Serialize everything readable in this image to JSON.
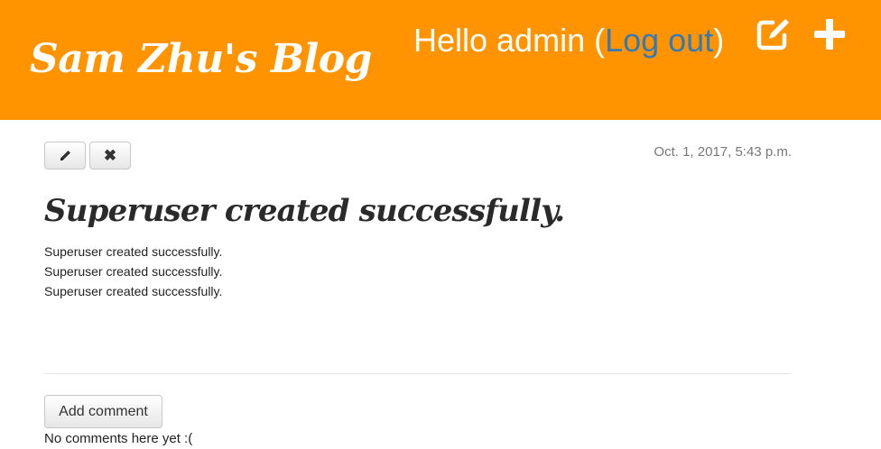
{
  "header": {
    "blog_title": "Sam Zhu's Blog",
    "greeting_prefix": "Hello admin (",
    "logout_label": "Log out",
    "greeting_suffix": ")",
    "background_color": "#ff9400",
    "icons": [
      "edit-post-icon",
      "add-post-icon"
    ]
  },
  "post": {
    "edit_icon": "pencil-icon",
    "delete_label": "✖",
    "date": "Oct. 1, 2017, 5:43 p.m.",
    "title": "Superuser created successfully.",
    "body_lines": [
      "Superuser created successfully.",
      "Superuser created successfully.",
      "Superuser created successfully."
    ]
  },
  "comments": {
    "add_label": "Add comment",
    "empty_text": "No comments here yet :("
  },
  "colors": {
    "link": "#337ab7",
    "muted_text": "#777777"
  }
}
